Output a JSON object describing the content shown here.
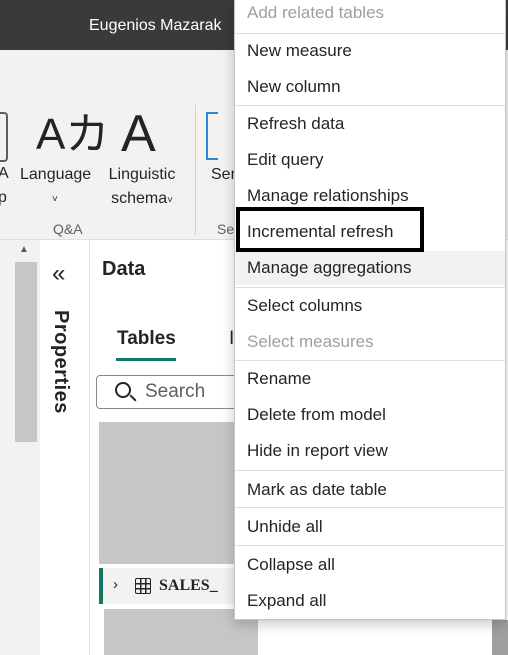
{
  "titlebar": {
    "user_name": "Eugenios Mazarak"
  },
  "ribbon": {
    "partial_a": "A",
    "partial_p": "p",
    "language_label": "Language",
    "language_glyph": "Aカ",
    "linguistic_glyph": "A",
    "linguistic_line1": "Linguistic",
    "linguistic_line2": "schema",
    "chevron": "˅",
    "qa_group": "Q&A",
    "partial_ser": "Ser",
    "partial_se": "Se"
  },
  "properties_pane": {
    "collapse_glyph": "«",
    "label": "Properties"
  },
  "data_pane": {
    "title": "Data",
    "tab_tables": "Tables",
    "tab_other_partial": "I",
    "search": {
      "placeholder": "Search",
      "value": ""
    },
    "table_row": {
      "chevron": "›",
      "label": "SALES_"
    }
  },
  "context_menu": {
    "items": [
      {
        "label": "Add related tables",
        "enabled": false
      },
      {
        "label": "New measure",
        "enabled": true
      },
      {
        "label": "New column",
        "enabled": true
      },
      {
        "label": "Refresh data",
        "enabled": true
      },
      {
        "label": "Edit query",
        "enabled": true
      },
      {
        "label": "Manage relationships",
        "enabled": true
      },
      {
        "label": "Incremental refresh",
        "enabled": true,
        "highlighted": true
      },
      {
        "label": "Manage aggregations",
        "enabled": true,
        "hovered": true
      },
      {
        "label": "Select columns",
        "enabled": true
      },
      {
        "label": "Select measures",
        "enabled": false
      },
      {
        "label": "Rename",
        "enabled": true
      },
      {
        "label": "Delete from model",
        "enabled": true
      },
      {
        "label": "Hide in report view",
        "enabled": true
      },
      {
        "label": "Mark as date table",
        "enabled": true
      },
      {
        "label": "Unhide all",
        "enabled": true
      },
      {
        "label": "Collapse all",
        "enabled": true
      },
      {
        "label": "Expand all",
        "enabled": true
      }
    ]
  },
  "colors": {
    "accent_teal": "#117865",
    "titlebar_bg": "#3b3a39",
    "highlight_border": "#000000",
    "disabled_text": "#a19f9d"
  }
}
